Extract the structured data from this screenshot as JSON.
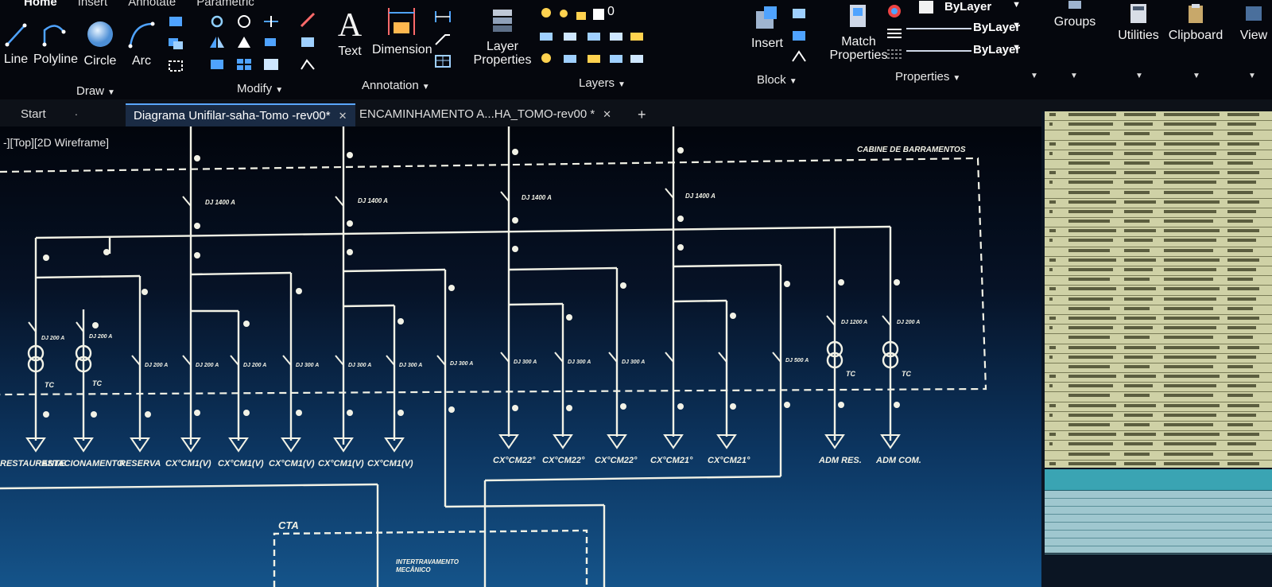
{
  "ribbon": {
    "menu_tabs": [
      "Home",
      "Insert",
      "Annotate",
      "Parametric"
    ],
    "draw": {
      "line": "Line",
      "polyline": "Polyline",
      "circle": "Circle",
      "arc": "Arc",
      "panel": "Draw"
    },
    "modify_panel": "Modify",
    "annotation": {
      "text": "Text",
      "dimension": "Dimension",
      "panel": "Annotation"
    },
    "layers": {
      "properties": "Layer\nProperties",
      "panel": "Layers",
      "current_layer": "0"
    },
    "block": {
      "insert": "Insert",
      "panel": "Block"
    },
    "properties": {
      "match": "Match\nProperties",
      "bylayer_color": "ByLayer",
      "bylayer_linetype": "ByLayer",
      "bylayer_lineweight": "ByLayer",
      "panel": "Properties"
    },
    "groups": "Groups",
    "utilities": "Utilities",
    "clipboard": "Clipboard",
    "view": "View"
  },
  "doc_tabs": {
    "start": "Start",
    "tab1": "Diagrama Unifilar-saha-Tomo -rev00*",
    "tab2": "ENCAMINHAMENTO A...HA_TOMO-rev00 *",
    "new_tab": "+"
  },
  "viewport": {
    "label": "-][Top][2D Wireframe]"
  },
  "drawing": {
    "cabin_label": "CABINE DE BARRAMENTOS",
    "breakers_top": [
      "DJ 1400 A",
      "DJ 1400 A",
      "DJ 1400 A",
      "DJ 1400 A"
    ],
    "breaker_ratings": [
      "DJ 200 A",
      "DJ 200 A",
      "DJ 200 A",
      "DJ 200 A",
      "DJ 200 A",
      "DJ 300 A",
      "DJ 300 A",
      "DJ 300 A",
      "DJ 300 A",
      "DJ 300 A",
      "DJ 300 A",
      "DJ 300 A",
      "DJ 500 A",
      "DJ 1200 A",
      "DJ 200 A"
    ],
    "tc_label": "TC",
    "feeders": [
      "RESTAURANTE",
      "ESTACIONAMENTO",
      "RESERVA",
      "CX°CM1(V)",
      "CX°CM1(V)",
      "CX°CM1(V)",
      "CX°CM1(V)",
      "CX°CM1(V)",
      "CX°CM22°",
      "CX°CM22°",
      "CX°CM22°",
      "CX°CM21°",
      "CX°CM21°",
      "ADM RES.",
      "ADM COM."
    ],
    "cta_label": "CTA",
    "interlock": "INTERTRAVAMENTO\nMECÂNICO"
  },
  "colors": {
    "ribbon_bg": "#05070d",
    "accent": "#5aa7ff",
    "drawing_line": "#f2f2e6"
  }
}
